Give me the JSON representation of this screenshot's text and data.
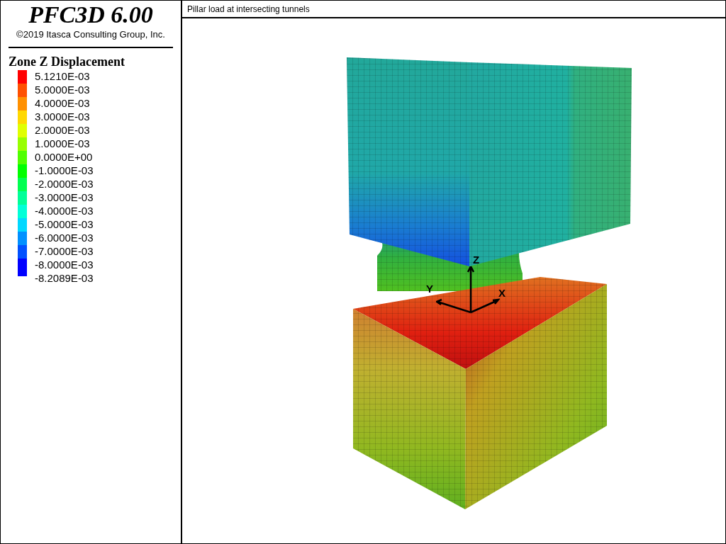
{
  "header": {
    "product": "PFC3D 6.00",
    "copyright": "©2019 Itasca Consulting Group, Inc."
  },
  "legend": {
    "title": "Zone Z Displacement",
    "labels": [
      "5.1210E-03",
      "5.0000E-03",
      "4.0000E-03",
      "3.0000E-03",
      "2.0000E-03",
      "1.0000E-03",
      "0.0000E+00",
      "-1.0000E-03",
      "-2.0000E-03",
      "-3.0000E-03",
      "-4.0000E-03",
      "-5.0000E-03",
      "-6.0000E-03",
      "-7.0000E-03",
      "-8.0000E-03",
      "-8.2089E-03"
    ],
    "bands": [
      {
        "color": "#ff0000"
      },
      {
        "color": "#ff5000"
      },
      {
        "color": "#ff9000"
      },
      {
        "color": "#ffd800"
      },
      {
        "color": "#e0ff00"
      },
      {
        "color": "#98ff00"
      },
      {
        "color": "#50ff00"
      },
      {
        "color": "#00ff00"
      },
      {
        "color": "#00ff50"
      },
      {
        "color": "#00ff98"
      },
      {
        "color": "#00ffd8"
      },
      {
        "color": "#00d8ff"
      },
      {
        "color": "#0090ff"
      },
      {
        "color": "#0050ff"
      },
      {
        "color": "#0000ff"
      }
    ]
  },
  "plot": {
    "title": "Pillar load at intersecting tunnels",
    "axes": {
      "x": "X",
      "y": "Y",
      "z": "Z"
    }
  }
}
